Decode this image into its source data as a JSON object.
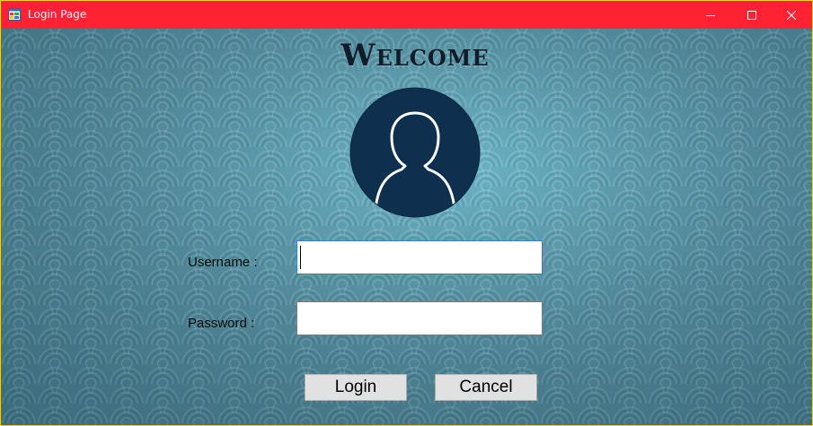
{
  "window": {
    "title": "Login Page"
  },
  "titlebar": {
    "icons": [
      "app-icon",
      "minimize-icon",
      "maximize-icon",
      "close-icon"
    ],
    "color": "#ff2233"
  },
  "main": {
    "welcome_text": "Welcome",
    "avatar_icon": "user-silhouette-icon",
    "username_label": "Username :",
    "username_value": "",
    "password_label": "Password :",
    "password_value": "",
    "login_label": "Login",
    "cancel_label": "Cancel"
  },
  "colors": {
    "background": "#5f9eb0",
    "avatar": "#0f2f4f",
    "text": "#0a0a0a"
  }
}
